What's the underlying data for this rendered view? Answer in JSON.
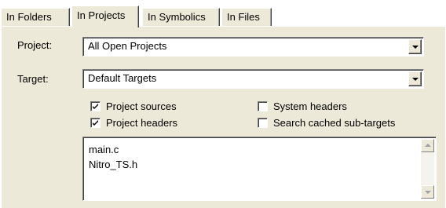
{
  "tabs": [
    {
      "label": "In Folders",
      "active": false
    },
    {
      "label": "In Projects",
      "active": true
    },
    {
      "label": "In Symbolics",
      "active": false
    },
    {
      "label": "In Files",
      "active": false
    }
  ],
  "project": {
    "label": "Project:",
    "value": "All Open Projects"
  },
  "target": {
    "label": "Target:",
    "value": "Default Targets"
  },
  "options": {
    "project_sources": {
      "label": "Project sources",
      "checked": true
    },
    "project_headers": {
      "label": "Project headers",
      "checked": true
    },
    "system_headers": {
      "label": "System headers",
      "checked": false
    },
    "search_cached": {
      "label": "Search cached sub-targets",
      "checked": false
    }
  },
  "file_list": [
    "main.c",
    "Nitro_TS.h"
  ],
  "colors": {
    "panel": "#ece9d8",
    "field": "#ffffff"
  }
}
